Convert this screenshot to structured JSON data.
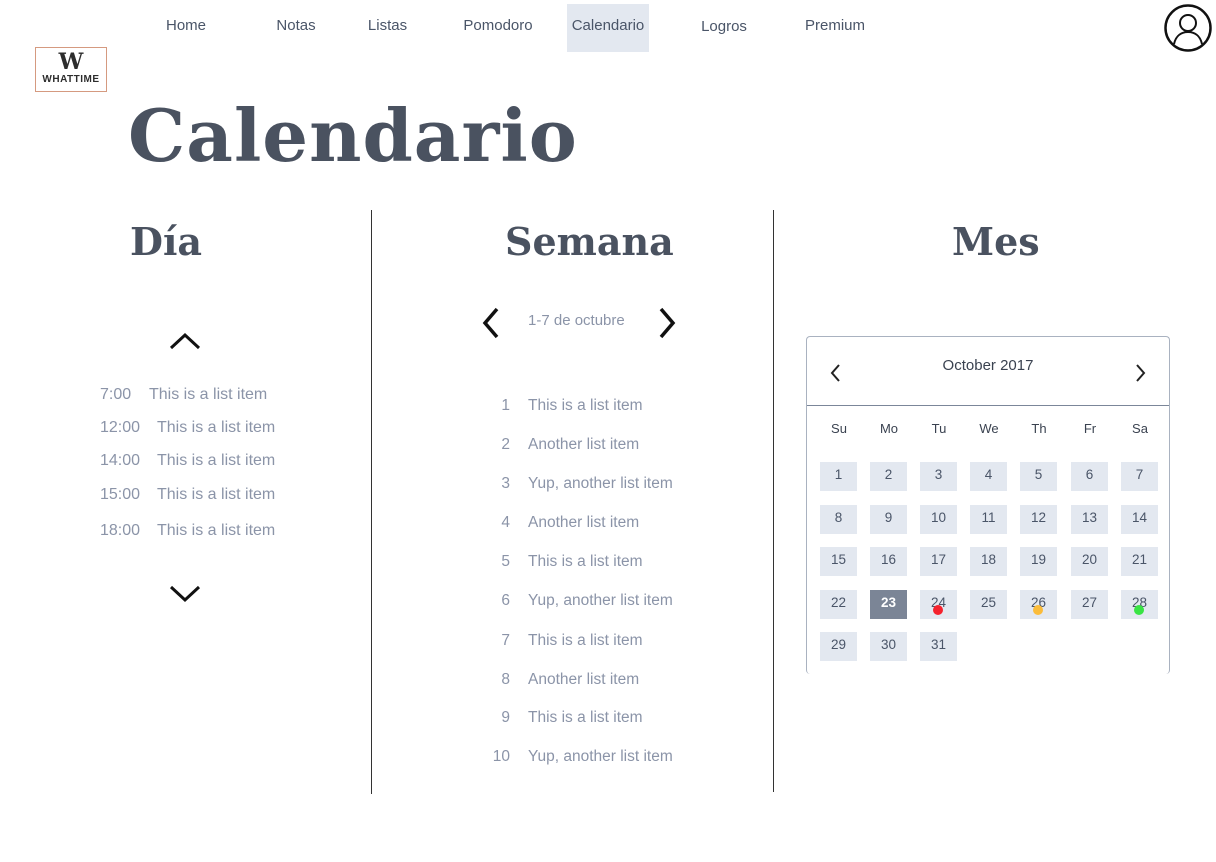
{
  "nav": {
    "items": [
      {
        "label": "Home"
      },
      {
        "label": "Notas"
      },
      {
        "label": "Listas"
      },
      {
        "label": "Pomodoro"
      },
      {
        "label": "Calendario",
        "active": true
      },
      {
        "label": "Logros"
      },
      {
        "label": "Premium"
      }
    ]
  },
  "logo": {
    "letter": "W",
    "text": "WHATTIME"
  },
  "page_title": "Calendario",
  "day": {
    "title": "Día",
    "items": [
      {
        "time": "7:00",
        "text": "This is a list item"
      },
      {
        "time": "12:00",
        "text": "This is a list item"
      },
      {
        "time": "14:00",
        "text": "This is a list item"
      },
      {
        "time": "15:00",
        "text": "This is a list item"
      },
      {
        "time": "18:00",
        "text": "This is a list item"
      }
    ]
  },
  "week": {
    "title": "Semana",
    "range_label": "1-7 de octubre",
    "items": [
      {
        "num": "1",
        "text": "This is a list item"
      },
      {
        "num": "2",
        "text": "Another list item"
      },
      {
        "num": "3",
        "text": "Yup, another list item"
      },
      {
        "num": "4",
        "text": "Another list item"
      },
      {
        "num": "5",
        "text": "This is a list item"
      },
      {
        "num": "6",
        "text": "Yup, another list item"
      },
      {
        "num": "7",
        "text": "This is a list item"
      },
      {
        "num": "8",
        "text": "Another list item"
      },
      {
        "num": "9",
        "text": "This is a list item"
      },
      {
        "num": "10",
        "text": "Yup, another list item"
      }
    ]
  },
  "month": {
    "title": "Mes",
    "calendar_title": "October 2017",
    "weekdays": [
      "Su",
      "Mo",
      "Tu",
      "We",
      "Th",
      "Fr",
      "Sa"
    ],
    "days": [
      "1",
      "2",
      "3",
      "4",
      "5",
      "6",
      "7",
      "8",
      "9",
      "10",
      "11",
      "12",
      "13",
      "14",
      "15",
      "16",
      "17",
      "18",
      "19",
      "20",
      "21",
      "22",
      "23",
      "24",
      "25",
      "26",
      "27",
      "28",
      "29",
      "30",
      "31"
    ],
    "today": "23",
    "events": [
      {
        "day": "24",
        "color": "#f5222d"
      },
      {
        "day": "26",
        "color": "#fbbc3a"
      },
      {
        "day": "28",
        "color": "#39e444"
      }
    ]
  },
  "colors": {
    "accent_bg": "#e3e8f0",
    "today_bg": "#7b8596",
    "text_muted": "#8b94a8",
    "heading": "#4a5260"
  },
  "icons": {
    "user": "user-icon",
    "up": "chevron-up-icon",
    "down": "chevron-down-icon",
    "prev": "chevron-left-icon",
    "next": "chevron-right-icon"
  }
}
